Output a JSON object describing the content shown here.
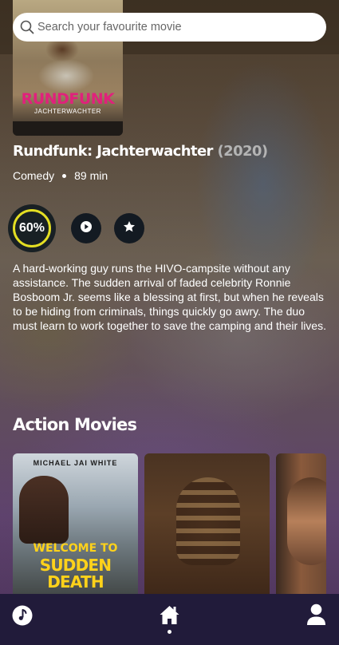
{
  "search": {
    "placeholder": "Search your favourite movie",
    "icon": "search-icon"
  },
  "featured": {
    "poster": {
      "title": "RUNDFUNK",
      "subtitle": "JACHTERWACHTER"
    },
    "title": "Rundfunk: Jachterwachter",
    "year": "(2020)",
    "genre": "Comedy",
    "runtime": "89 min",
    "rating": {
      "label": "60%",
      "value": 0.6,
      "ring_color": "#e3de23"
    },
    "actions": {
      "play_icon": "play-icon",
      "favorite_icon": "star-icon"
    },
    "overview": "A hard-working guy runs the HIVO-campsite without any assistance. The sudden arrival of faded celebrity Ronnie Bosboom Jr. seems like a blessing at first, but when he reveals to be hiding from criminals, things quickly go awry. The duo must learn to work together to save the camping and their lives."
  },
  "section": {
    "title": "Action Movies",
    "cards": [
      {
        "top_text": "MICHAEL JAI WHITE",
        "title_line1": "WELCOME TO",
        "title_line2": "SUDDEN DEATH"
      },
      {
        "top_text": "",
        "title_line1": "",
        "title_line2": ""
      },
      {
        "top_text": "",
        "title_line1": "",
        "title_line2": ""
      }
    ]
  },
  "bottom_nav": {
    "items": [
      "music-icon",
      "home-icon",
      "profile-icon"
    ],
    "active": "home-icon",
    "background": "#211b3a"
  }
}
